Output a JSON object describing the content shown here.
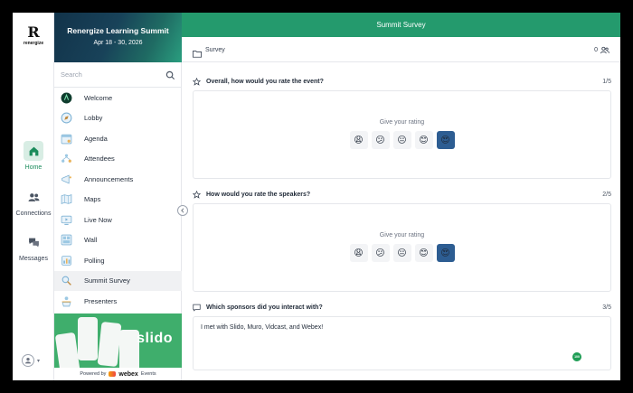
{
  "brand": {
    "logo_mark": "R",
    "logo_text": "renergize"
  },
  "rail": {
    "items": [
      {
        "label": "Home",
        "icon": "home-icon",
        "active": true
      },
      {
        "label": "Connections",
        "icon": "people-icon",
        "active": false
      },
      {
        "label": "Messages",
        "icon": "chat-icon",
        "active": false
      }
    ]
  },
  "event": {
    "title": "Renergize Learning Summit",
    "dates": "Apr 18 - 30, 2026"
  },
  "search": {
    "placeholder": "Search"
  },
  "menu": [
    {
      "label": "Welcome",
      "icon": "welcome-icon"
    },
    {
      "label": "Lobby",
      "icon": "compass-icon"
    },
    {
      "label": "Agenda",
      "icon": "calendar-icon"
    },
    {
      "label": "Attendees",
      "icon": "attendees-icon"
    },
    {
      "label": "Announcements",
      "icon": "megaphone-icon"
    },
    {
      "label": "Maps",
      "icon": "map-icon"
    },
    {
      "label": "Live Now",
      "icon": "live-icon"
    },
    {
      "label": "Wall",
      "icon": "wall-icon"
    },
    {
      "label": "Polling",
      "icon": "polling-icon"
    },
    {
      "label": "Summit Survey",
      "icon": "search-icon",
      "active": true
    },
    {
      "label": "Presenters",
      "icon": "presenters-icon"
    }
  ],
  "ad": {
    "text": "slido"
  },
  "powered": {
    "prefix": "Powered by",
    "brand": "webex",
    "suffix": "Events"
  },
  "header": {
    "title": "Summit Survey"
  },
  "survey": {
    "label": "Survey",
    "participants": "0"
  },
  "questions": [
    {
      "text": "Overall, how would you rate the event?",
      "counter": "1/5",
      "prompt": "Give your rating",
      "selected_index": 4
    },
    {
      "text": "How would you rate the speakers?",
      "counter": "2/5",
      "prompt": "Give your rating",
      "selected_index": 4
    },
    {
      "text": "Which sponsors did you interact with?",
      "counter": "3/5",
      "answer": "I met with Slido, Muro, Vidcast, and Webex!",
      "badge": "100"
    }
  ],
  "emoji_scale": [
    "😩",
    "😕",
    "😐",
    "😊",
    "😍"
  ],
  "colors": {
    "accent": "#249a6d",
    "selected": "#2d5d92",
    "ad_green": "#3fae6c"
  }
}
